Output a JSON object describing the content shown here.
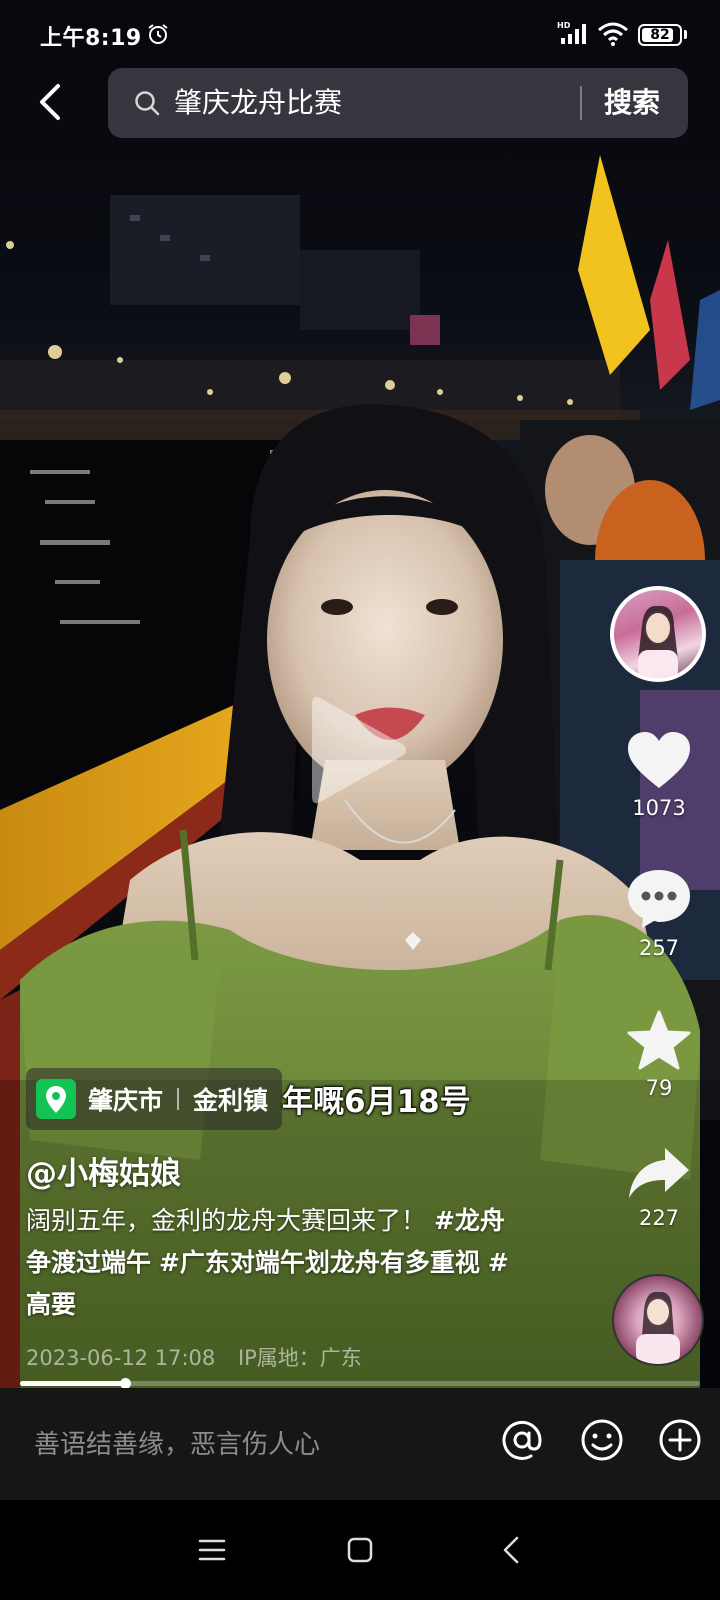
{
  "status_bar": {
    "time": "上午8:19",
    "network_label": "HD",
    "battery": "82"
  },
  "search": {
    "query": "肇庆龙舟比赛",
    "submit_label": "搜索"
  },
  "video": {
    "subtitle": "年嘅6月18号",
    "progress": 0.155
  },
  "rail": {
    "likes": "1073",
    "comments": "257",
    "favorites": "79",
    "shares": "227"
  },
  "location": {
    "city": "肇庆市",
    "town": "金利镇"
  },
  "post": {
    "author": "@小梅姑娘",
    "caption_text": "阔别五年，金利的龙舟大赛回来了！",
    "hashtags": [
      "#龙舟争渡过端午",
      "#广东对端午划龙舟有多重视",
      "#高要"
    ],
    "date": "2023-06-12 17:08",
    "ip_location": "IP属地：广东"
  },
  "comment_bar": {
    "placeholder": "善语结善缘，恶言伤人心"
  },
  "icons": {
    "back": "chevron-left-icon",
    "search": "search-icon",
    "like": "heart-icon",
    "comment": "comment-bubble-icon",
    "favorite": "star-icon",
    "share": "share-arrow-icon",
    "mention": "at-icon",
    "emoji": "emoji-icon",
    "add": "plus-circle-icon"
  },
  "colors": {
    "location_badge": "#12c454",
    "banner_yellow": "#f2c21e",
    "dress_green": "#6d8a36"
  }
}
